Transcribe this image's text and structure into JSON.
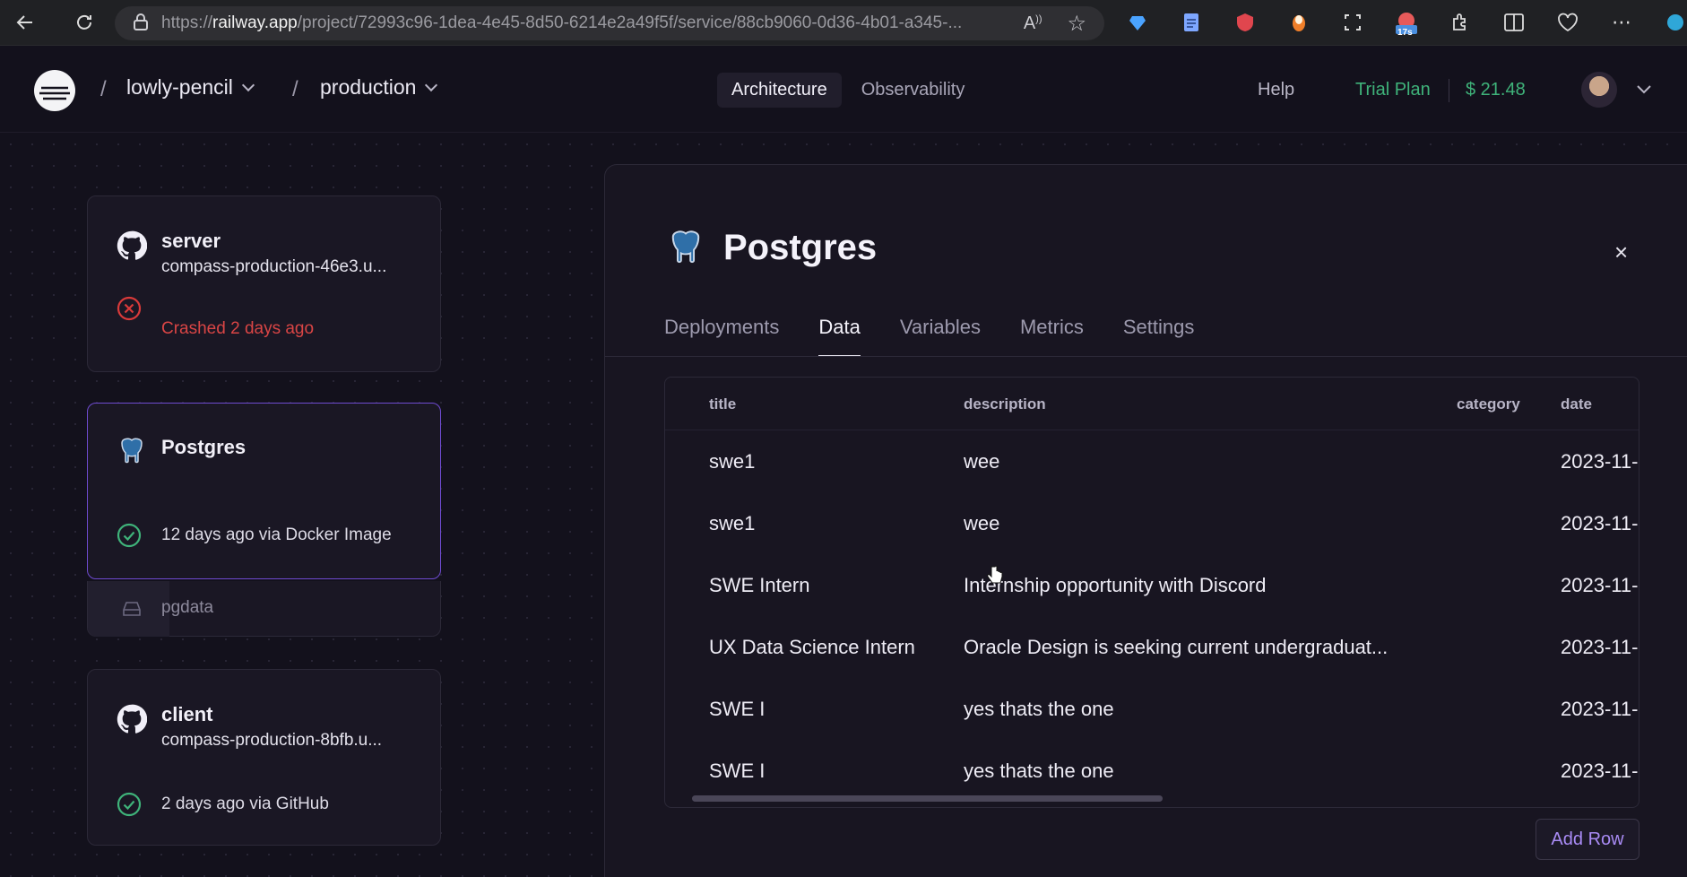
{
  "browser": {
    "url_prefix": "https://",
    "url_host": "railway.app",
    "url_path": "/project/72993c96-1dea-4e45-8d50-6214e2a49f5f/service/88cb9060-0d36-4b01-a345-...",
    "timer_badge": "17s"
  },
  "header": {
    "project": "lowly-pencil",
    "environment": "production",
    "tabs": [
      {
        "label": "Architecture",
        "active": true
      },
      {
        "label": "Observability",
        "active": false
      }
    ],
    "help": "Help",
    "plan": "Trial Plan",
    "credit": "$ 21.48",
    "accent_green": "#3fb37a"
  },
  "services": [
    {
      "name": "server",
      "subtitle": "compass-production-46e3.u...",
      "status": "Crashed 2 days ago",
      "status_type": "error",
      "icon": "github-icon"
    },
    {
      "name": "Postgres",
      "subtitle": "",
      "status": "12 days ago via Docker Image",
      "status_type": "success",
      "icon": "postgres-icon",
      "volume": "pgdata"
    },
    {
      "name": "client",
      "subtitle": "compass-production-8bfb.u...",
      "status": "2 days ago via GitHub",
      "status_type": "success",
      "icon": "github-icon"
    }
  ],
  "panel": {
    "title": "Postgres",
    "close": "×",
    "tabs": [
      {
        "label": "Deployments",
        "active": false
      },
      {
        "label": "Data",
        "active": true
      },
      {
        "label": "Variables",
        "active": false
      },
      {
        "label": "Metrics",
        "active": false
      },
      {
        "label": "Settings",
        "active": false
      }
    ],
    "table": {
      "columns": [
        "title",
        "description",
        "category",
        "date"
      ],
      "rows": [
        {
          "title": "swe1",
          "description": "wee",
          "category": "",
          "date": "2023-11-"
        },
        {
          "title": "swe1",
          "description": "wee",
          "category": "",
          "date": "2023-11-"
        },
        {
          "title": "SWE Intern",
          "description": "Internship opportunity with Discord",
          "category": "",
          "date": "2023-11-"
        },
        {
          "title": "UX Data Science Intern",
          "description": "Oracle Design is seeking current undergraduat...",
          "category": "",
          "date": "2023-11-"
        },
        {
          "title": "SWE I",
          "description": "yes thats the one",
          "category": "",
          "date": "2023-11-"
        },
        {
          "title": "SWE I",
          "description": "yes thats the one",
          "category": "",
          "date": "2023-11-"
        }
      ]
    },
    "add_row": "Add Row"
  }
}
